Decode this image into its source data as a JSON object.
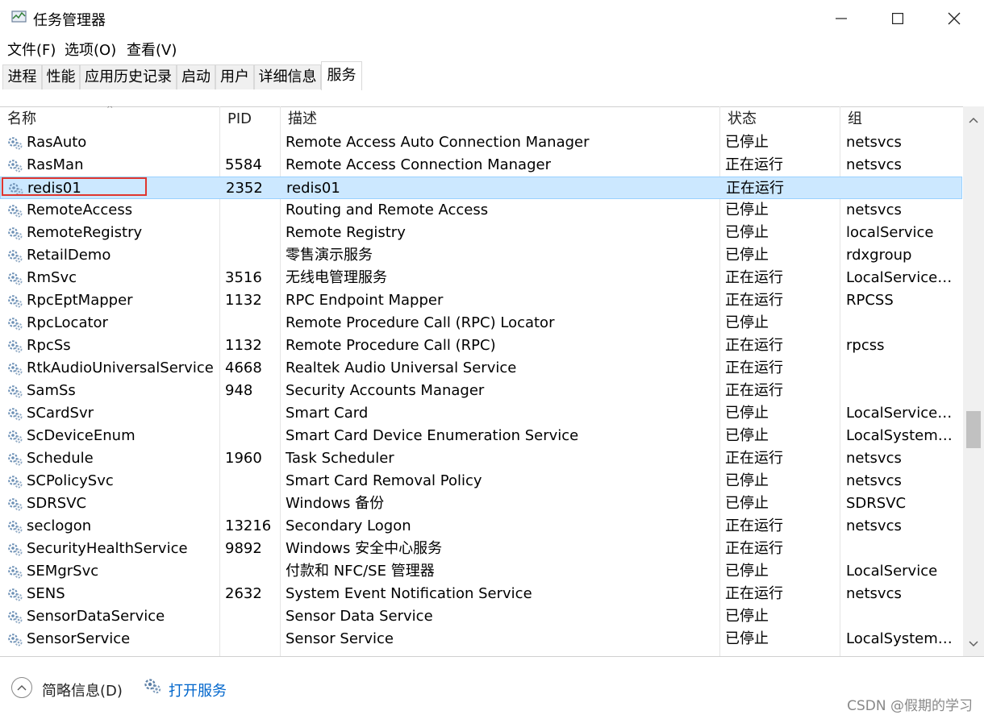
{
  "window": {
    "title": "任务管理器",
    "icon": "task-manager-icon",
    "controls": [
      "minimize-icon",
      "maximize-icon",
      "close-icon"
    ]
  },
  "menu": [
    "文件(F)",
    "选项(O)",
    "查看(V)"
  ],
  "tabs": [
    "进程",
    "性能",
    "应用历史记录",
    "启动",
    "用户",
    "详细信息",
    "服务"
  ],
  "active_tab": "服务",
  "columns": [
    "名称",
    "PID",
    "描述",
    "状态",
    "组"
  ],
  "selected_row": "redis01",
  "rows": [
    {
      "name": "RasAuto",
      "pid": "",
      "desc": "Remote Access Auto Connection Manager",
      "status": "已停止",
      "group": "netsvcs"
    },
    {
      "name": "RasMan",
      "pid": "5584",
      "desc": "Remote Access Connection Manager",
      "status": "正在运行",
      "group": "netsvcs"
    },
    {
      "name": "redis01",
      "pid": "2352",
      "desc": "redis01",
      "status": "正在运行",
      "group": ""
    },
    {
      "name": "RemoteAccess",
      "pid": "",
      "desc": "Routing and Remote Access",
      "status": "已停止",
      "group": "netsvcs"
    },
    {
      "name": "RemoteRegistry",
      "pid": "",
      "desc": "Remote Registry",
      "status": "已停止",
      "group": "localService"
    },
    {
      "name": "RetailDemo",
      "pid": "",
      "desc": "零售演示服务",
      "status": "已停止",
      "group": "rdxgroup"
    },
    {
      "name": "RmSvc",
      "pid": "3516",
      "desc": "无线电管理服务",
      "status": "正在运行",
      "group": "LocalServiceN..."
    },
    {
      "name": "RpcEptMapper",
      "pid": "1132",
      "desc": "RPC Endpoint Mapper",
      "status": "正在运行",
      "group": "RPCSS"
    },
    {
      "name": "RpcLocator",
      "pid": "",
      "desc": "Remote Procedure Call (RPC) Locator",
      "status": "已停止",
      "group": ""
    },
    {
      "name": "RpcSs",
      "pid": "1132",
      "desc": "Remote Procedure Call (RPC)",
      "status": "正在运行",
      "group": "rpcss"
    },
    {
      "name": "RtkAudioUniversalService",
      "pid": "4668",
      "desc": "Realtek Audio Universal Service",
      "status": "正在运行",
      "group": ""
    },
    {
      "name": "SamSs",
      "pid": "948",
      "desc": "Security Accounts Manager",
      "status": "正在运行",
      "group": ""
    },
    {
      "name": "SCardSvr",
      "pid": "",
      "desc": "Smart Card",
      "status": "已停止",
      "group": "LocalServiceA..."
    },
    {
      "name": "ScDeviceEnum",
      "pid": "",
      "desc": "Smart Card Device Enumeration Service",
      "status": "已停止",
      "group": "LocalSystemN..."
    },
    {
      "name": "Schedule",
      "pid": "1960",
      "desc": "Task Scheduler",
      "status": "正在运行",
      "group": "netsvcs"
    },
    {
      "name": "SCPolicySvc",
      "pid": "",
      "desc": "Smart Card Removal Policy",
      "status": "已停止",
      "group": "netsvcs"
    },
    {
      "name": "SDRSVC",
      "pid": "",
      "desc": "Windows 备份",
      "status": "已停止",
      "group": "SDRSVC"
    },
    {
      "name": "seclogon",
      "pid": "13216",
      "desc": "Secondary Logon",
      "status": "正在运行",
      "group": "netsvcs"
    },
    {
      "name": "SecurityHealthService",
      "pid": "9892",
      "desc": "Windows 安全中心服务",
      "status": "正在运行",
      "group": ""
    },
    {
      "name": "SEMgrSvc",
      "pid": "",
      "desc": "付款和 NFC/SE 管理器",
      "status": "已停止",
      "group": "LocalService"
    },
    {
      "name": "SENS",
      "pid": "2632",
      "desc": "System Event Notification Service",
      "status": "正在运行",
      "group": "netsvcs"
    },
    {
      "name": "SensorDataService",
      "pid": "",
      "desc": "Sensor Data Service",
      "status": "已停止",
      "group": ""
    },
    {
      "name": "SensorService",
      "pid": "",
      "desc": "Sensor Service",
      "status": "已停止",
      "group": "LocalSystemN..."
    }
  ],
  "footer": {
    "brief_label": "简略信息(D)",
    "open_services_label": "打开服务"
  },
  "watermark": "CSDN @假期的学习",
  "colors": {
    "selected_bg": "#cce8ff",
    "selected_border": "#99d1ff",
    "highlight_box": "#e0362f",
    "link": "#0066cc"
  }
}
